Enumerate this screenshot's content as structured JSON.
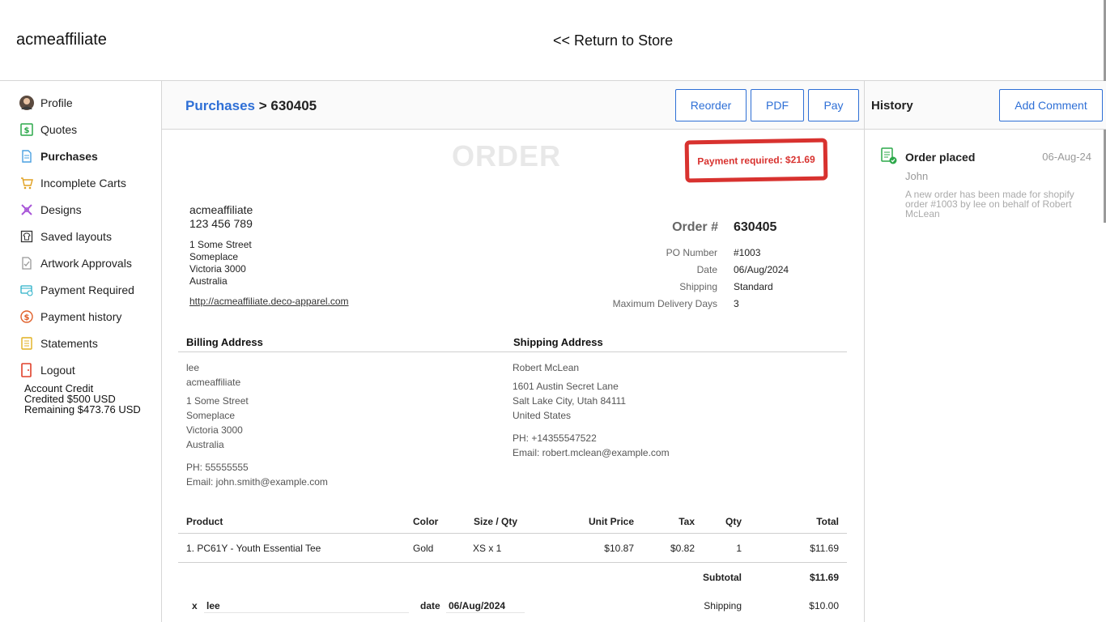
{
  "header": {
    "brand": "acmeaffiliate",
    "return_link": "<< Return to Store"
  },
  "sidebar": {
    "items": [
      {
        "label": "Profile",
        "icon": "avatar"
      },
      {
        "label": "Quotes",
        "icon": "dollar-icon"
      },
      {
        "label": "Purchases",
        "icon": "document-icon"
      },
      {
        "label": "Incomplete Carts",
        "icon": "cart-icon"
      },
      {
        "label": "Designs",
        "icon": "designs-icon"
      },
      {
        "label": "Saved layouts",
        "icon": "shirt-icon"
      },
      {
        "label": "Artwork Approvals",
        "icon": "approval-icon"
      },
      {
        "label": "Payment Required",
        "icon": "payment-icon"
      },
      {
        "label": "Payment history",
        "icon": "coin-icon"
      },
      {
        "label": "Statements",
        "icon": "statement-icon"
      },
      {
        "label": "Logout",
        "icon": "logout-icon"
      }
    ],
    "credit": {
      "title": "Account Credit",
      "credited": "Credited $500 USD",
      "remaining": "Remaining $473.76 USD"
    }
  },
  "main": {
    "breadcrumb_link": "Purchases",
    "breadcrumb_sep": " > ",
    "order_id": "630405",
    "buttons": {
      "reorder": "Reorder",
      "pdf": "PDF",
      "pay": "Pay"
    }
  },
  "history": {
    "title": "History",
    "add_comment": "Add Comment",
    "entries": [
      {
        "title": "Order placed",
        "date": "06-Aug-24",
        "author": "John",
        "text": "A new order has been made for shopify order #1003 by lee on behalf of Robert McLean"
      }
    ]
  },
  "order": {
    "heading": "ORDER",
    "stamp": "Payment required: $21.69",
    "company": {
      "name": "acmeaffiliate",
      "phone": "123 456 789",
      "street": "1 Some Street",
      "city": "Someplace",
      "state": "Victoria 3000",
      "country": "Australia",
      "url": "http://acmeaffiliate.deco-apparel.com"
    },
    "details": {
      "order_label": "Order #",
      "order_value": "630405",
      "po_label": "PO Number",
      "po_value": "#1003",
      "date_label": "Date",
      "date_value": "06/Aug/2024",
      "shipping_label": "Shipping",
      "shipping_value": "Standard",
      "mdd_label": "Maximum Delivery Days",
      "mdd_value": "3"
    },
    "billing": {
      "heading": "Billing Address",
      "name": "lee",
      "company": "acmeaffiliate",
      "street": "1 Some Street",
      "city": "Someplace",
      "state": "Victoria 3000",
      "country": "Australia",
      "phone": "PH: 55555555",
      "email": "Email: john.smith@example.com"
    },
    "shipping": {
      "heading": "Shipping Address",
      "name": "Robert McLean",
      "street": "1601 Austin Secret Lane",
      "city": "Salt Lake City, Utah 84111",
      "country": "United States",
      "phone": "PH: +14355547522",
      "email": "Email: robert.mclean@example.com"
    },
    "table": {
      "headers": {
        "product": "Product",
        "color": "Color",
        "size": "Size / Qty",
        "unit": "Unit Price",
        "tax": "Tax",
        "qty": "Qty",
        "total": "Total"
      },
      "rows": [
        {
          "product": "1. PC61Y - Youth Essential Tee",
          "color": "Gold",
          "size": "XS x 1",
          "unit": "$10.87",
          "tax": "$0.82",
          "qty": "1",
          "total": "$11.69"
        }
      ],
      "subtotal_label": "Subtotal",
      "subtotal_value": "$11.69",
      "shipping_label": "Shipping",
      "shipping_value": "$10.00"
    },
    "signature": {
      "x_label": "x",
      "name": "lee",
      "date_label": "date",
      "date_value": "06/Aug/2024"
    }
  }
}
